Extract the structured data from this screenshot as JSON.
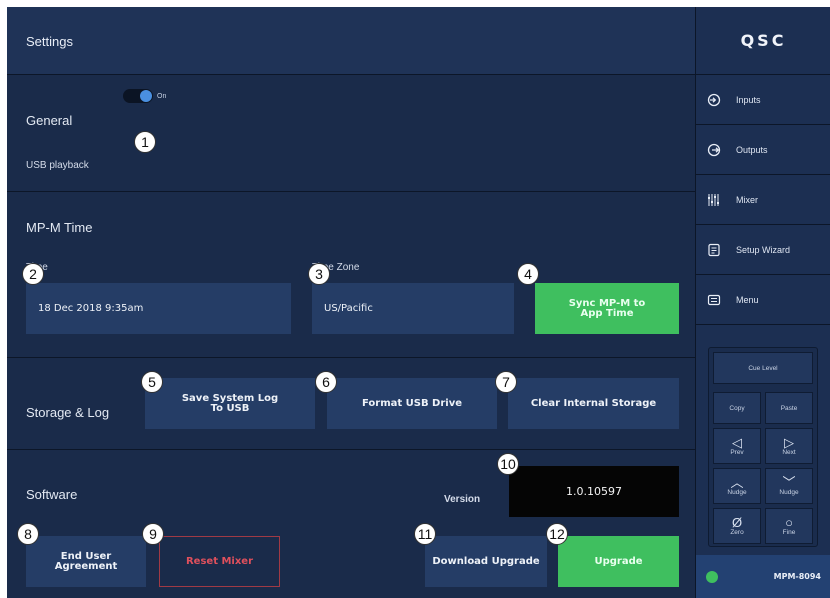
{
  "header": {
    "title": "Settings",
    "brand": "QSC"
  },
  "general": {
    "title": "General",
    "usb_playback": {
      "label": "USB playback",
      "state": "On",
      "enabled": true
    }
  },
  "mpm_time": {
    "title": "MP-M Time",
    "time_label": "Time",
    "time_value": "18 Dec 2018 9:35am",
    "zone_label": "Time Zone",
    "zone_value": "US/Pacific",
    "sync_button": "Sync MP-M to App Time"
  },
  "storage": {
    "title": "Storage & Log",
    "save_log_button": "Save System Log To USB",
    "format_button": "Format USB Drive",
    "clear_button": "Clear Internal Storage"
  },
  "software": {
    "title": "Software",
    "version_label": "Version",
    "version_value": "1.0.10597",
    "eula_button": "End User Agreement",
    "reset_button": "Reset Mixer",
    "download_button": "Download Upgrade",
    "upgrade_button": "Upgrade"
  },
  "callouts": [
    "1",
    "2",
    "3",
    "4",
    "5",
    "6",
    "7",
    "8",
    "9",
    "10",
    "11",
    "12"
  ],
  "sidebar": {
    "items": [
      {
        "label": "Inputs",
        "icon": "inputs-icon"
      },
      {
        "label": "Outputs",
        "icon": "outputs-icon"
      },
      {
        "label": "Mixer",
        "icon": "mixer-icon"
      },
      {
        "label": "Setup Wizard",
        "icon": "setup-wizard-icon"
      },
      {
        "label": "Menu",
        "icon": "menu-icon"
      }
    ],
    "cue": {
      "cue_level": "Cue Level",
      "copy": "Copy",
      "paste": "Paste",
      "prev": "Prev",
      "next": "Next",
      "nudge_up": "Nudge",
      "nudge_down": "Nudge",
      "zero": "Zero",
      "fine": "Fine"
    },
    "device": "MPM-8094"
  },
  "colors": {
    "background": "#1a2b4a",
    "header": "#1f3357",
    "field": "#253d66",
    "accent_green": "#3fbf5f",
    "danger_red": "#e0505c",
    "toggle_blue": "#4a8fe0"
  }
}
